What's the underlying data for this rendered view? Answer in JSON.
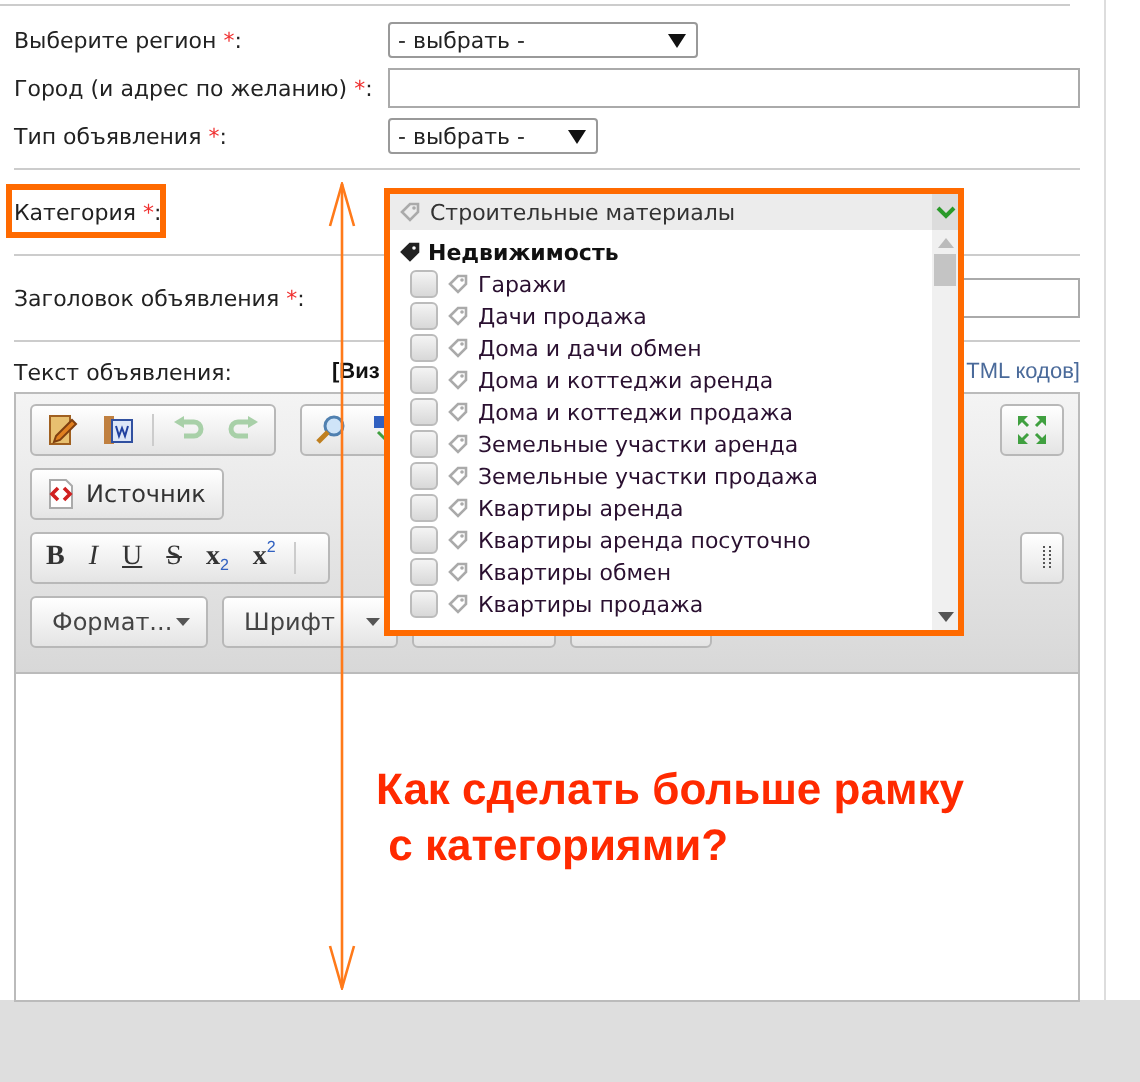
{
  "form": {
    "fields": [
      {
        "kind": "select",
        "label": "Выберите регион",
        "mark": "*",
        "suffix": ":",
        "value": "- выбрать -"
      },
      {
        "kind": "text",
        "label": "Город (и адрес по желанию)",
        "mark": "*",
        "suffix": ":"
      },
      {
        "kind": "select",
        "label": "Тип объявления",
        "mark": "*",
        "suffix": ":",
        "value": "- выбрать -"
      }
    ],
    "category": {
      "label": "Категория",
      "mark": "*",
      "suffix": ":"
    },
    "title_field": {
      "label": "Заголовок объявления",
      "mark": "*",
      "suffix": ":"
    },
    "text_field": {
      "label": "Текст объявления:",
      "mode_left": "[Виз",
      "mode_right": "TML кодов]"
    }
  },
  "editor": {
    "source_button": "Источник",
    "style_buttons": [
      {
        "kind": "bold",
        "label": "B"
      },
      {
        "kind": "italic",
        "label": "I"
      },
      {
        "kind": "underline",
        "label": "U"
      },
      {
        "kind": "strike",
        "label": "S"
      },
      {
        "kind": "subscript",
        "label": "x$_{2}$"
      },
      {
        "kind": "superscript",
        "label": "x$^{2}$"
      }
    ],
    "format_button": "Формат...",
    "font_button": "Шрифт"
  },
  "category_dropdown": {
    "selected": "Строительные материалы",
    "group": "Недвижимость",
    "items": [
      {
        "label": "Гаражи",
        "checked": false
      },
      {
        "label": "Дачи продажа",
        "checked": false
      },
      {
        "label": "Дома и дачи обмен",
        "checked": false
      },
      {
        "label": "Дома и коттеджи аренда",
        "checked": false
      },
      {
        "label": "Дома и коттеджи продажа",
        "checked": false
      },
      {
        "label": "Земельные участки аренда",
        "checked": false
      },
      {
        "label": "Земельные участки продажа",
        "checked": false
      },
      {
        "label": "Квартиры аренда",
        "checked": false
      },
      {
        "label": "Квартиры аренда посуточно",
        "checked": false
      },
      {
        "label": "Квартиры обмен",
        "checked": false
      },
      {
        "label": "Квартиры продажа",
        "checked": false
      }
    ]
  },
  "annotation": {
    "question": "Как сделать больше рамку\n с категориями?"
  }
}
